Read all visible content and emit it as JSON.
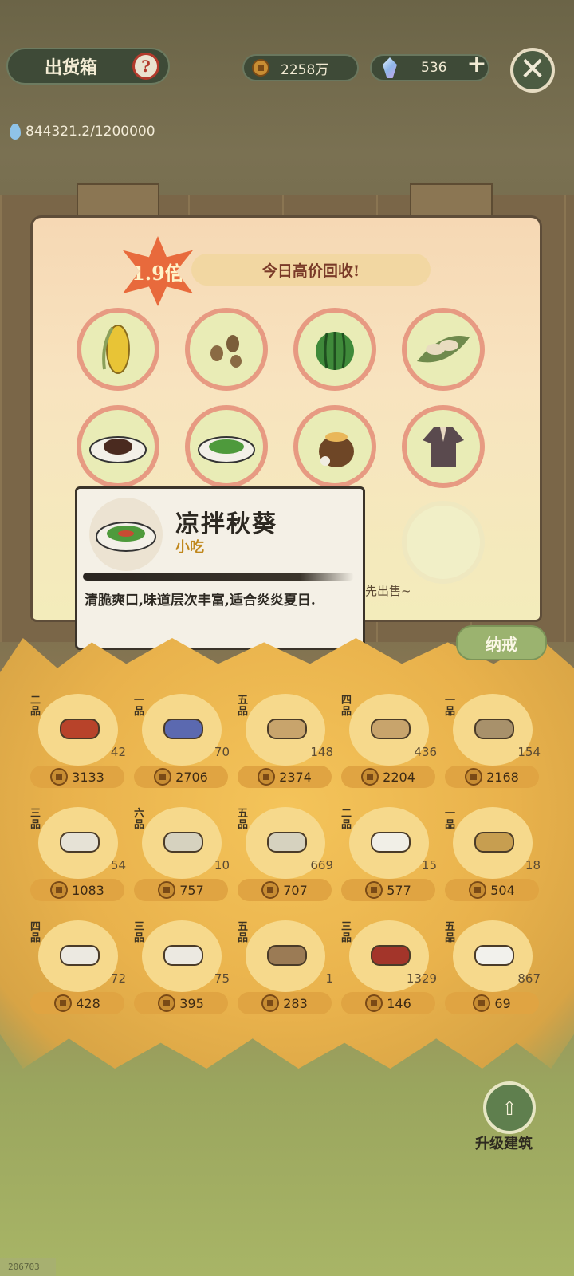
{
  "header": {
    "title": "出货箱",
    "help_icon": "question-icon",
    "coins": "2258万",
    "gems": "536",
    "plus": "+",
    "close": "✕"
  },
  "water": {
    "value": "844321.2/1200000"
  },
  "board": {
    "multiplier": "1.9倍",
    "banner": "今日高价回收!",
    "slots": [
      {
        "icon": "corn-icon"
      },
      {
        "icon": "seeds-icon"
      },
      {
        "icon": "watermelon-icon"
      },
      {
        "icon": "dumplings-on-leaf-icon"
      },
      {
        "icon": "braised-pork-icon"
      },
      {
        "icon": "okra-salad-icon"
      },
      {
        "icon": "wine-jar-icon"
      },
      {
        "icon": "robe-icon"
      }
    ],
    "hint": "先出售~"
  },
  "tooltip": {
    "name": "凉拌秋葵",
    "type": "小吃",
    "desc": "清脆爽口,味道层次丰富,适合炎炎夏日."
  },
  "storage": {
    "tab": "纳戒",
    "items": [
      {
        "grade": "二品",
        "count": "42",
        "price": "3133",
        "icon": "red-cloth-icon",
        "color": "#b8432a"
      },
      {
        "grade": "一品",
        "count": "70",
        "price": "2706",
        "icon": "blue-cloth-icon",
        "color": "#5b69b0"
      },
      {
        "grade": "五品",
        "count": "148",
        "price": "2374",
        "icon": "paper-roll-icon",
        "color": "#c8a46c"
      },
      {
        "grade": "四品",
        "count": "436",
        "price": "2204",
        "icon": "paper-roll-icon",
        "color": "#c8a46c"
      },
      {
        "grade": "一品",
        "count": "154",
        "price": "2168",
        "icon": "clay-jar-icon",
        "color": "#a8916b"
      },
      {
        "grade": "三品",
        "count": "54",
        "price": "1083",
        "icon": "white-cloth-roll-icon",
        "color": "#e6e2d6"
      },
      {
        "grade": "六品",
        "count": "10",
        "price": "757",
        "icon": "linen-roll-icon",
        "color": "#d6d2bf"
      },
      {
        "grade": "五品",
        "count": "669",
        "price": "707",
        "icon": "linen-roll-icon",
        "color": "#d6d2bf"
      },
      {
        "grade": "二品",
        "count": "15",
        "price": "577",
        "icon": "white-cloth-icon",
        "color": "#f1efe7"
      },
      {
        "grade": "一品",
        "count": "18",
        "price": "504",
        "icon": "ore-icon",
        "color": "#c79e50"
      },
      {
        "grade": "四品",
        "count": "72",
        "price": "428",
        "icon": "thread-spool-icon",
        "color": "#ece9e1"
      },
      {
        "grade": "三品",
        "count": "75",
        "price": "395",
        "icon": "thread-spool-icon",
        "color": "#ece9e1"
      },
      {
        "grade": "五品",
        "count": "1",
        "price": "283",
        "icon": "rope-icon",
        "color": "#9b7b55"
      },
      {
        "grade": "三品",
        "count": "1329",
        "price": "146",
        "icon": "red-thread-spool-icon",
        "color": "#a3352a"
      },
      {
        "grade": "五品",
        "count": "867",
        "price": "69",
        "icon": "cocoons-on-leaf-icon",
        "color": "#f2f1ec"
      }
    ]
  },
  "upgrade": {
    "icon": "upgrade-building-icon",
    "label": "升级建筑"
  },
  "build_id": "206703"
}
